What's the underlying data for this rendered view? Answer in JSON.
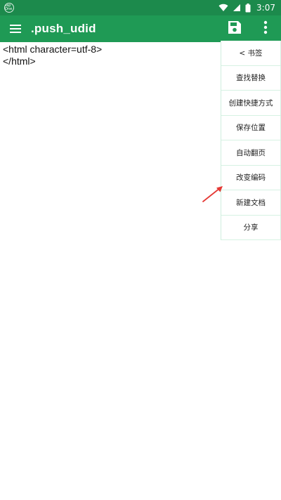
{
  "status_bar": {
    "app_badge_text": "Tap One",
    "time": "3:07",
    "background": "#1c8a4c",
    "icons": [
      "wifi-icon",
      "signal-icon",
      "battery-icon"
    ]
  },
  "app_bar": {
    "title": ".push_udid",
    "background": "#1f9a55",
    "icons": [
      "menu-icon",
      "save-icon",
      "more-vertical-icon"
    ]
  },
  "editor": {
    "content": "<html character=utf-8>\n</html>"
  },
  "side_menu": {
    "items": [
      {
        "label": "< 书签"
      },
      {
        "label": "查找替换"
      },
      {
        "label": "创建快捷方式"
      },
      {
        "label": "保存位置"
      },
      {
        "label": "自动翻页"
      },
      {
        "label": "改变编码"
      },
      {
        "label": "新建文档"
      },
      {
        "label": "分享"
      }
    ]
  },
  "annotation": {
    "arrow_color": "#e53935"
  }
}
